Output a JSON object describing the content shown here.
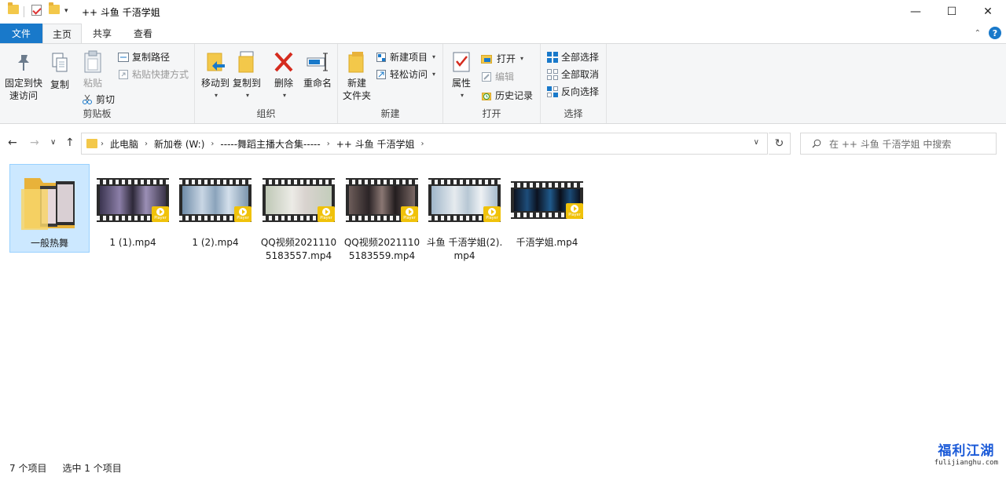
{
  "window": {
    "title": "++ 斗鱼 千浯学姐",
    "minimize": "—",
    "maximize": "☐",
    "close": "✕"
  },
  "ribbon_tabs": [
    {
      "label": "文件"
    },
    {
      "label": "主页"
    },
    {
      "label": "共享"
    },
    {
      "label": "查看"
    }
  ],
  "ribbon": {
    "clipboard": {
      "label": "剪贴板",
      "pin_line1": "固定到快",
      "pin_line2": "速访问",
      "copy": "复制",
      "paste": "粘贴",
      "copy_path": "复制路径",
      "paste_shortcut": "粘贴快捷方式",
      "cut": "剪切"
    },
    "organize": {
      "label": "组织",
      "move_to": "移动到",
      "copy_to": "复制到",
      "delete": "删除",
      "rename": "重命名"
    },
    "new": {
      "label": "新建",
      "new_folder_line1": "新建",
      "new_folder_line2": "文件夹",
      "new_item": "新建项目",
      "easy_access": "轻松访问"
    },
    "open": {
      "label": "打开",
      "properties": "属性",
      "open": "打开",
      "edit": "编辑",
      "history": "历史记录"
    },
    "select": {
      "label": "选择",
      "select_all": "全部选择",
      "select_none": "全部取消",
      "invert": "反向选择"
    }
  },
  "breadcrumb": [
    "此电脑",
    "新加卷 (W:)",
    "-----舞蹈主播大合集-----",
    "++ 斗鱼 千浯学姐"
  ],
  "search": {
    "placeholder": "在 ++ 斗鱼 千浯学姐 中搜索"
  },
  "items": [
    {
      "name": "一般热舞",
      "type": "folder",
      "selected": true
    },
    {
      "name": "1 (1).mp4",
      "type": "video",
      "selected": false
    },
    {
      "name": "1 (2).mp4",
      "type": "video",
      "selected": false
    },
    {
      "name": "QQ视频20211105183557.mp4",
      "type": "video",
      "selected": false
    },
    {
      "name": "QQ视频20211105183559.mp4",
      "type": "video",
      "selected": false
    },
    {
      "name": "斗鱼 千浯学姐(2).mp4",
      "type": "video",
      "selected": false
    },
    {
      "name": "千浯学姐.mp4",
      "type": "video",
      "selected": false
    }
  ],
  "badge_text": "Player",
  "status": {
    "count": "7 个项目",
    "selected": "选中 1 个项目"
  },
  "watermark": {
    "cn": "福利江湖",
    "url": "fulijianghu.com"
  },
  "colors": {
    "accent": "#1979ca",
    "selection_bg": "#cce8ff",
    "selection_border": "#99d1ff",
    "badge": "#f0c20a"
  }
}
